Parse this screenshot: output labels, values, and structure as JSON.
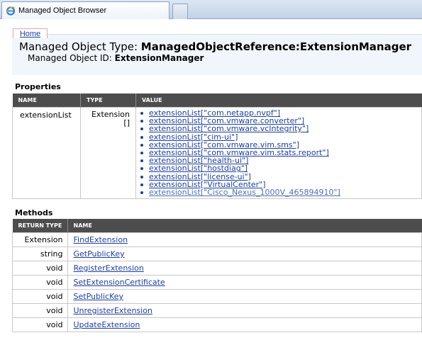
{
  "browser": {
    "tab_title": "Managed Object Browser"
  },
  "header": {
    "home_label": "Home",
    "type_label": "Managed Object Type:",
    "type_value": "ManagedObjectReference:ExtensionManager",
    "id_label": "Managed Object ID:",
    "id_value": "ExtensionManager"
  },
  "properties": {
    "title": "Properties",
    "columns": [
      "NAME",
      "TYPE",
      "VALUE"
    ],
    "rows": [
      {
        "name": "extensionList",
        "type_line1": "Extension",
        "type_line2": "[]",
        "values": [
          "extensionList[\"com.netapp.nvpf\"]",
          "extensionList[\"com.vmware.converter\"]",
          "extensionList[\"com.vmware.vcIntegrity\"]",
          "extensionList[\"cim-ui\"]",
          "extensionList[\"com.vmware.vim.sms\"]",
          "extensionList[\"com.vmware.vim.stats.report\"]",
          "extensionList[\"health-ui\"]",
          "extensionList[\"hostdiag\"]",
          "extensionList[\"license-ui\"]",
          "extensionList[\"VirtualCenter\"]",
          "extensionList[\"Cisco_Nexus_1000V_465894910\"]"
        ]
      }
    ]
  },
  "methods": {
    "title": "Methods",
    "columns": [
      "RETURN TYPE",
      "NAME"
    ],
    "rows": [
      {
        "return_type": "Extension",
        "name": "FindExtension"
      },
      {
        "return_type": "string",
        "name": "GetPublicKey"
      },
      {
        "return_type": "void",
        "name": "RegisterExtension"
      },
      {
        "return_type": "void",
        "name": "SetExtensionCertificate"
      },
      {
        "return_type": "void",
        "name": "SetPublicKey"
      },
      {
        "return_type": "void",
        "name": "UnregisterExtension"
      },
      {
        "return_type": "void",
        "name": "UpdateExtension"
      }
    ]
  },
  "colors": {
    "link": "#1f3f9c",
    "visited_link": "#4f6fb8",
    "table_header_bg": "#4d4d4d",
    "header_bg": "#f0f6fb"
  },
  "icons": {
    "tab_favicon": "internet-explorer-icon"
  }
}
